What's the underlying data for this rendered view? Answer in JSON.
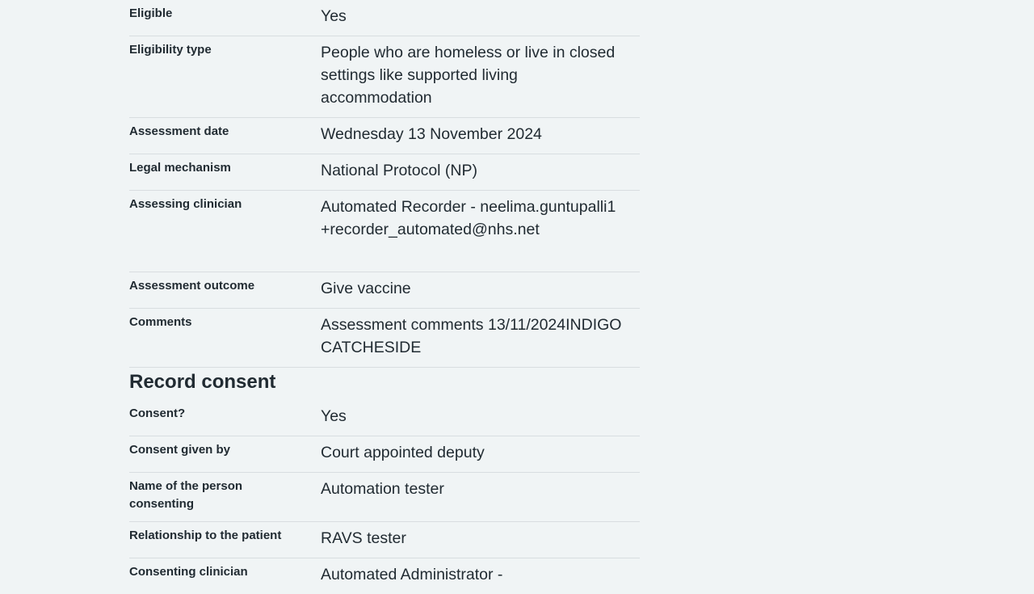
{
  "assessment": {
    "rows": [
      {
        "label": "Eligible",
        "value": "Yes"
      },
      {
        "label": "Eligibility type",
        "value": "People who are homeless or live in closed settings like supported living accommodation"
      },
      {
        "label": "Assessment date",
        "value": "Wednesday 13 November 2024"
      },
      {
        "label": "Legal mechanism",
        "value": "National Protocol (NP)"
      },
      {
        "label": "Assessing clinician",
        "value": "Automated Recorder - neelima.guntupalli1+recorder_automated@nhs.net"
      },
      {
        "label": "Assessment outcome",
        "value": "Give vaccine"
      },
      {
        "label": "Comments",
        "value": "Assessment comments 13/11/2024INDIGO CATCHESIDE"
      }
    ]
  },
  "consent": {
    "heading": "Record consent",
    "rows": [
      {
        "label": "Consent?",
        "value": "Yes"
      },
      {
        "label": "Consent given by",
        "value": "Court appointed deputy"
      },
      {
        "label": "Name of the person consenting",
        "value": "Automation tester"
      },
      {
        "label": "Relationship to the patient",
        "value": "RAVS tester"
      },
      {
        "label": "Consenting clinician",
        "value": "Automated Administrator -"
      }
    ]
  }
}
